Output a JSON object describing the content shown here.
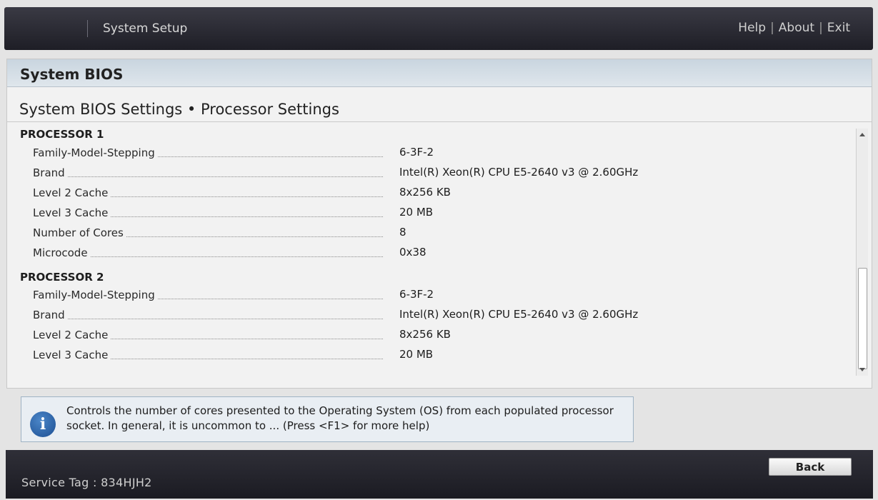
{
  "topbar": {
    "title": "System Setup",
    "links": {
      "help": "Help",
      "about": "About",
      "exit": "Exit",
      "separator": "|"
    }
  },
  "panel": {
    "title": "System BIOS",
    "subtitle": "System BIOS Settings • Processor Settings"
  },
  "processors": [
    {
      "heading": "PROCESSOR 1",
      "rows": [
        {
          "label": "Family-Model-Stepping",
          "value": "6-3F-2"
        },
        {
          "label": "Brand",
          "value": "Intel(R) Xeon(R) CPU E5-2640 v3 @ 2.60GHz"
        },
        {
          "label": "Level 2 Cache",
          "value": "8x256 KB"
        },
        {
          "label": "Level 3 Cache",
          "value": "20 MB"
        },
        {
          "label": "Number of Cores",
          "value": "8"
        },
        {
          "label": "Microcode",
          "value": "0x38"
        }
      ]
    },
    {
      "heading": "PROCESSOR 2",
      "rows": [
        {
          "label": "Family-Model-Stepping",
          "value": "6-3F-2"
        },
        {
          "label": "Brand",
          "value": "Intel(R) Xeon(R) CPU E5-2640 v3 @ 2.60GHz"
        },
        {
          "label": "Level 2 Cache",
          "value": "8x256 KB"
        },
        {
          "label": "Level 3 Cache",
          "value": "20 MB"
        }
      ]
    }
  ],
  "help": {
    "icon": "info-icon",
    "icon_glyph": "i",
    "text": "Controls the number of cores presented to the Operating System (OS) from each populated processor socket. In general, it is uncommon to ... (Press <F1> for more help)"
  },
  "footer": {
    "service_tag": "Service Tag : 834HJH2",
    "back_label": "Back"
  }
}
